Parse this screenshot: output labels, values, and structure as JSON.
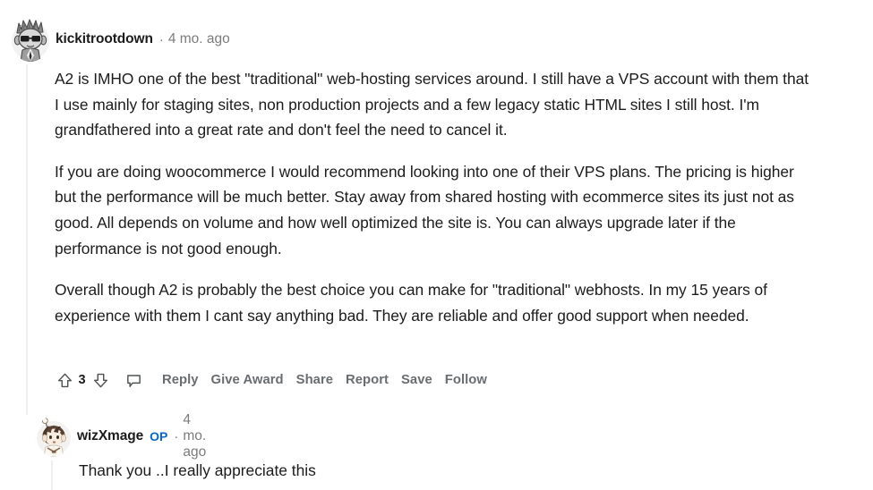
{
  "comments": [
    {
      "username": "kickitrootdown",
      "op": false,
      "op_label": "",
      "separator": "·",
      "timestamp": "4 mo. ago",
      "avatar_name": "avatar-kickitrootdown",
      "paragraphs": [
        "A2 is IMHO one of the best \"traditional\" web-hosting services around. I still have a VPS account with them that I use mainly for staging sites, non production projects and a few legacy static HTML sites I still host. I'm grandfathered into a great rate and don't feel the need to cancel it.",
        "If you are doing woocommerce I would recommend looking into one of their VPS plans. The pricing is higher but the performance will be much better. Stay away from shared hosting with ecommerce sites its just not as good. All depends on volume and how well optimized the site is. You can always upgrade later if the performance is not good enough.",
        "Overall though A2 is probably the best choice you can make for \"traditional\" webhosts. In my 15 years of experience with them I cant say anything bad. They are reliable and offer good support when needed."
      ],
      "actions": {
        "upvote_icon": "upvote-arrow-icon",
        "vote_count": "3",
        "downvote_icon": "downvote-arrow-icon",
        "comment_icon": "comment-bubble-icon",
        "links": [
          "Reply",
          "Give Award",
          "Share",
          "Report",
          "Save",
          "Follow"
        ]
      }
    },
    {
      "username": "wizXmage",
      "op": true,
      "op_label": "OP",
      "separator": "·",
      "timestamp": "4 mo. ago",
      "avatar_name": "avatar-wizxmage",
      "paragraphs": [
        "Thank you ..I really appreciate this"
      ]
    }
  ],
  "colors": {
    "text": "#1c1c1c",
    "meta": "#7c7c7c",
    "action": "#6a6d70",
    "op_badge": "#0a66c2",
    "thread_line": "#edeff1",
    "background": "#ffffff"
  }
}
